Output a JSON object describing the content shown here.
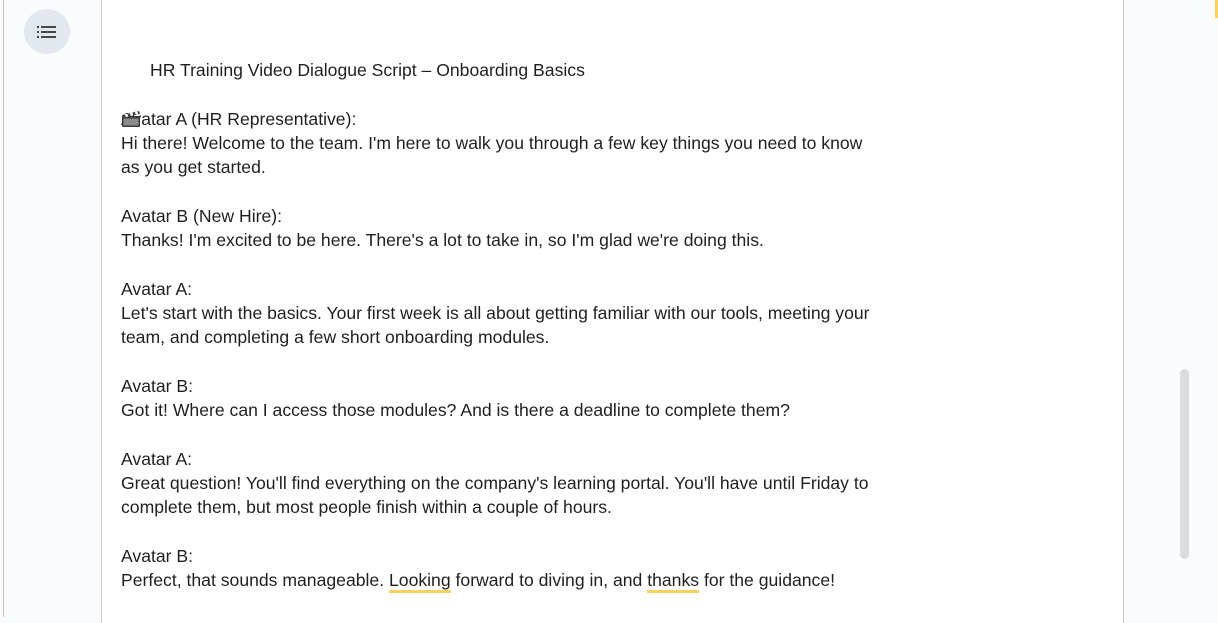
{
  "sidebar": {
    "outline_icon": "outline-list-icon"
  },
  "document": {
    "title": "HR Training Video Dialogue Script – Onboarding Basics",
    "title_icon": "clapperboard-icon",
    "blocks": [
      {
        "speaker": "Avatar A (HR Representative):",
        "lines": [
          "Hi there! Welcome to the team. I'm here to walk you through a few key things you need to know",
          "as you get started."
        ]
      },
      {
        "speaker": "Avatar B (New Hire):",
        "lines": [
          "Thanks! I'm excited to be here. There's a lot to take in, so I'm glad we're doing this."
        ]
      },
      {
        "speaker": "Avatar A:",
        "lines": [
          "Let's start with the basics. Your first week is all about getting familiar with our tools, meeting your",
          "team, and completing a few short onboarding modules."
        ]
      },
      {
        "speaker": "Avatar B:",
        "lines": [
          "Got it! Where can I access those modules? And is there a deadline to complete them?"
        ]
      },
      {
        "speaker": "Avatar A:",
        "lines": [
          "Great question! You'll find everything on the company's learning portal. You'll have until Friday to",
          "complete them, but most people finish within a couple of hours."
        ]
      },
      {
        "speaker": "Avatar B:",
        "last_line": {
          "before": "Perfect, that sounds manageable. ",
          "flag1": "Looking",
          "middle": " forward to diving in, and ",
          "flag2": "thanks",
          "after": " for the guidance!"
        }
      }
    ],
    "spellcheck_color": "#fbd35a"
  }
}
